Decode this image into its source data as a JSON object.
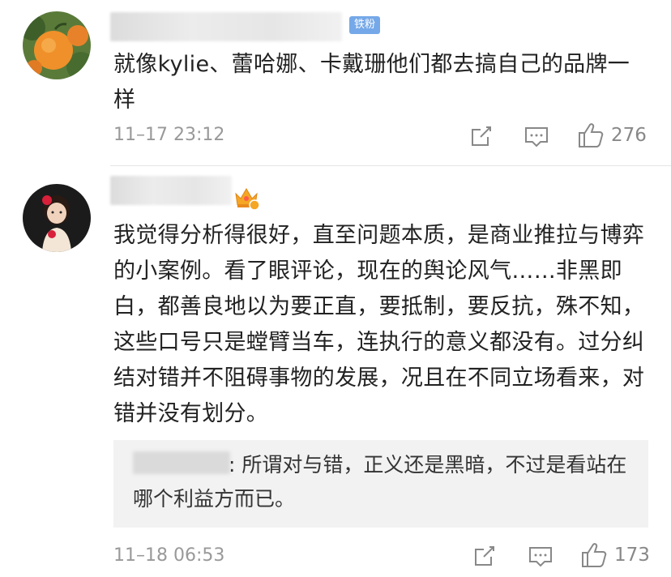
{
  "comments": [
    {
      "badge": "铁粉",
      "text": "就像kylie、蕾哈娜、卡戴珊他们都去搞自己的品牌一样",
      "time": "11–17 23:12",
      "likes": "276"
    },
    {
      "badge_icon": "crown-level-icon",
      "text": "我觉得分析得很好，直至问题本质，是商业推拉与博弈的小案例。看了眼评论，现在的舆论风气……非黑即白，都善良地以为要正直，要抵制，要反抗，殊不知，这些口号只是螳臂当车，连执行的意义都没有。过分纠结对错并不阻碍事物的发展，况且在不同立场看来，对错并没有划分。",
      "reply": ": 所谓对与错，正义还是黑暗，不过是看站在哪个利益方而已。",
      "time": "11–18 06:53",
      "likes": "173"
    }
  ],
  "colors": {
    "badge_blue": "#75a8e8",
    "meta_gray": "#999999",
    "reply_bg": "#f2f2f2"
  }
}
